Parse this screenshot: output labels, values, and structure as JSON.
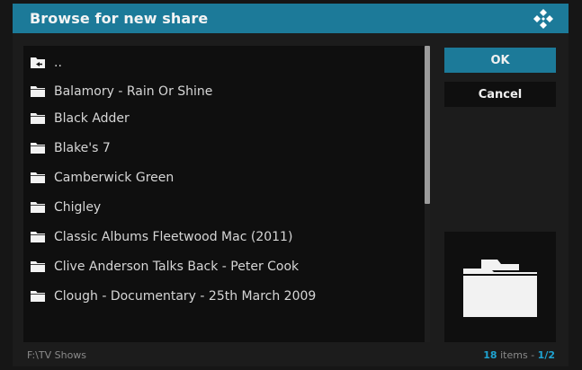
{
  "dialog": {
    "title": "Browse for new share",
    "logo_icon": "kodi-logo-icon"
  },
  "list": {
    "items": [
      {
        "label": "..",
        "icon": "folder-back-icon"
      },
      {
        "label": "Balamory - Rain Or Shine",
        "icon": "folder-icon"
      },
      {
        "label": "Black Adder",
        "icon": "folder-icon"
      },
      {
        "label": "Blake's 7",
        "icon": "folder-icon"
      },
      {
        "label": "Camberwick Green",
        "icon": "folder-icon"
      },
      {
        "label": "Chigley",
        "icon": "folder-icon"
      },
      {
        "label": "Classic Albums Fleetwood Mac (2011)",
        "icon": "folder-icon"
      },
      {
        "label": "Clive Anderson Talks Back - Peter Cook",
        "icon": "folder-icon"
      },
      {
        "label": "Clough - Documentary - 25th March 2009",
        "icon": "folder-icon"
      }
    ]
  },
  "buttons": {
    "ok": "OK",
    "cancel": "Cancel"
  },
  "footer": {
    "path": "F:\\TV Shows",
    "count": "18",
    "items_word": "items",
    "separator": "-",
    "page": "1/2"
  },
  "colors": {
    "accent": "#1c7a99",
    "highlight": "#1fa3d1"
  }
}
